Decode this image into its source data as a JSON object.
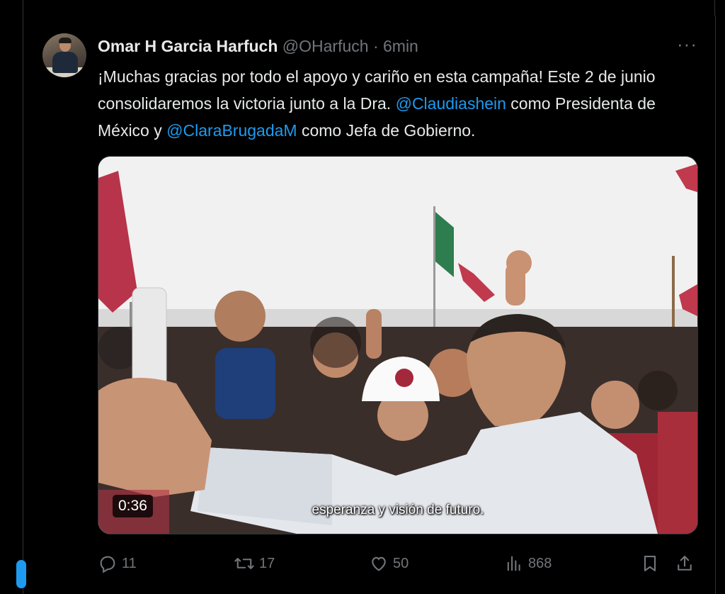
{
  "tweet": {
    "display_name": "Omar H Garcia Harfuch",
    "handle": "@OHarfuch",
    "separator": "·",
    "time": "6min",
    "more_label": "···",
    "text_1": "¡Muchas gracias por todo el apoyo y cariño en esta campaña! Este 2 de junio consolidaremos la victoria junto a la Dra. ",
    "mention_1": "@Claudiashein",
    "text_2": " como Presidenta de México y ",
    "mention_2": "@ClaraBrugadaM",
    "text_3": " como Jefa de Gobierno."
  },
  "media": {
    "duration": "0:36",
    "subtitle": "esperanza y visión de futuro."
  },
  "actions": {
    "replies": "11",
    "retweets": "17",
    "likes": "50",
    "views": "868"
  },
  "colors": {
    "background": "#000000",
    "text": "#e7e9ea",
    "muted": "#71767b",
    "link": "#1d9bf0",
    "border": "#2f3336"
  }
}
